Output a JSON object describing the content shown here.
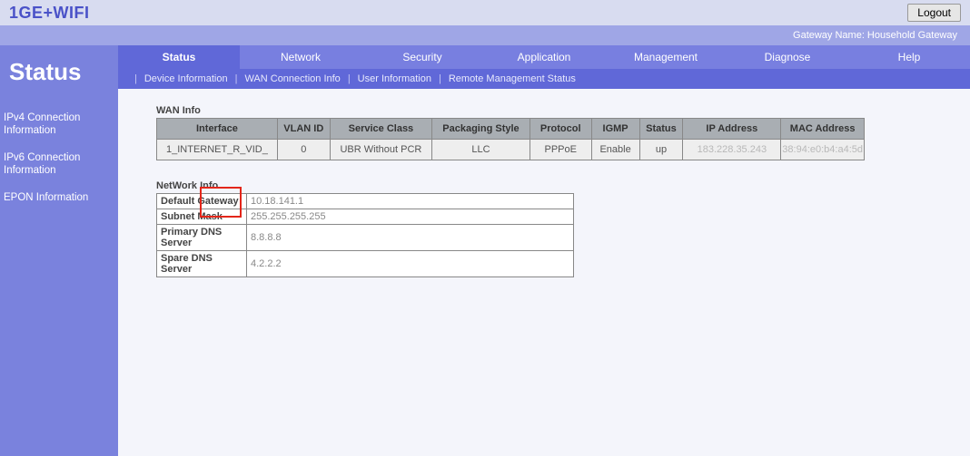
{
  "brand": "1GE+WIFI",
  "logout_label": "Logout",
  "gateway_name_label": "Gateway Name: Household Gateway",
  "side_title": "Status",
  "sidebar_links": {
    "ipv4": "IPv4 Connection Information",
    "ipv6": "IPv6 Connection Information",
    "epon": "EPON Information"
  },
  "tabs": {
    "status": "Status",
    "network": "Network",
    "security": "Security",
    "application": "Application",
    "management": "Management",
    "diagnose": "Diagnose",
    "help": "Help"
  },
  "subtabs": {
    "device": "Device Information",
    "wan": "WAN Connection Info",
    "user": "User Information",
    "remote": "Remote Management Status"
  },
  "wan_section_title": "WAN Info",
  "wan_headers": {
    "interface": "Interface",
    "vlan": "VLAN ID",
    "service": "Service Class",
    "packaging": "Packaging Style",
    "protocol": "Protocol",
    "igmp": "IGMP",
    "status": "Status",
    "ip": "IP Address",
    "mac": "MAC Address"
  },
  "wan_row": {
    "interface": "1_INTERNET_R_VID_",
    "vlan": "0",
    "service": "UBR Without PCR",
    "packaging": "LLC",
    "protocol": "PPPoE",
    "igmp": "Enable",
    "status": "up",
    "ip": "183.228.35.243",
    "mac": "38:94:e0:b4:a4:5d"
  },
  "netinfo_section_title": "NetWork Info",
  "netinfo": {
    "gateway_lbl": "Default Gateway",
    "gateway_val": "10.18.141.1",
    "subnet_lbl": "Subnet Mask",
    "subnet_val": "255.255.255.255",
    "pdns_lbl": "Primary DNS Server",
    "pdns_val": "8.8.8.8",
    "sdns_lbl": "Spare DNS Server",
    "sdns_val": "4.2.2.2"
  }
}
